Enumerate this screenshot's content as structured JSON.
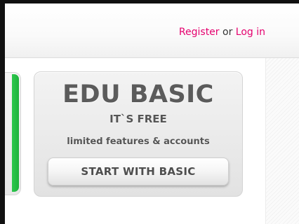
{
  "header": {
    "register_label": "Register",
    "separator": "or",
    "login_label": "Log in"
  },
  "plan": {
    "title": "EDU BASIC",
    "price": "IT`S FREE",
    "description": "limited features & accounts",
    "button_label": "START WITH BASIC"
  },
  "colors": {
    "link": "#e5006e",
    "accent_green": "#2dc84d",
    "card_text": "#5b5b5b"
  }
}
